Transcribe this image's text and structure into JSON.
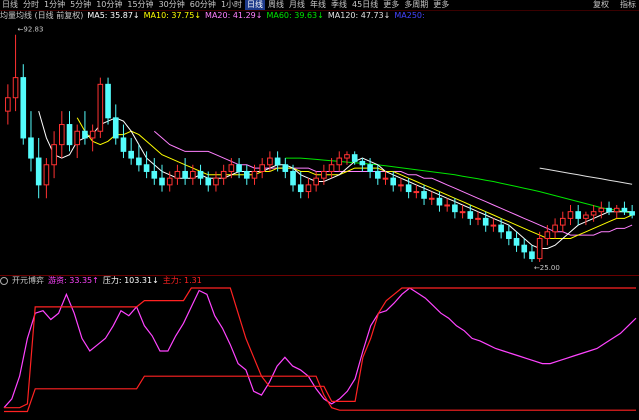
{
  "toolbar": {
    "items": [
      {
        "label": "日线",
        "active": false
      },
      {
        "label": "分时",
        "active": false
      },
      {
        "label": "1分钟",
        "active": false
      },
      {
        "label": "5分钟",
        "active": false
      },
      {
        "label": "10分钟",
        "active": false
      },
      {
        "label": "15分钟",
        "active": false
      },
      {
        "label": "30分钟",
        "active": false
      },
      {
        "label": "60分钟",
        "active": false
      },
      {
        "label": "1小时",
        "active": false
      },
      {
        "label": "日线",
        "active": true
      },
      {
        "label": "周线",
        "active": false
      },
      {
        "label": "月线",
        "active": false
      },
      {
        "label": "年线",
        "active": false
      },
      {
        "label": "季线",
        "active": false
      },
      {
        "label": "45日线",
        "active": false
      },
      {
        "label": "更多",
        "active": false
      },
      {
        "label": "多周期",
        "active": false
      },
      {
        "label": "更多",
        "active": false
      }
    ],
    "right": [
      "复权",
      "指标"
    ]
  },
  "legend": {
    "title": "均量均线 (日线 前复权)",
    "ma5": "MA5: 35.87↓",
    "ma10": "MA10: 37.75↓",
    "ma20": "MA20: 41.29↓",
    "ma60": "MA60: 39.63↓",
    "ma120": "MA120: 47.73↓",
    "ma250": "MA250:"
  },
  "sub_legend": {
    "title": "开元博弈",
    "item1": "游资: 33.35↑",
    "item2": "压力: 103.31↓",
    "item3": "主力: 1.31"
  },
  "colors": {
    "up": "#ff3232",
    "down": "#54fcfc",
    "ma5": "#ffffff",
    "ma10": "#ffff00",
    "ma20": "#ff80ff",
    "ma60": "#00e600",
    "ma120": "#e0e0e0",
    "ma250": "#4444ff",
    "sub_magenta": "#ff44ff",
    "sub_red": "#ff2222"
  },
  "chart_data": [
    {
      "type": "candlestick",
      "title": "",
      "y_annotations": [
        {
          "label": "92.83",
          "value": 92.83
        },
        {
          "label": "25.00",
          "value": 25.0
        }
      ],
      "ylim": [
        22,
        96
      ],
      "candles": [
        [
          70,
          78,
          66,
          74
        ],
        [
          74,
          92.8,
          70,
          80
        ],
        [
          80,
          84,
          60,
          62
        ],
        [
          62,
          70,
          52,
          56
        ],
        [
          56,
          62,
          44,
          48
        ],
        [
          48,
          56,
          44,
          54
        ],
        [
          54,
          64,
          50,
          60
        ],
        [
          60,
          70,
          56,
          66
        ],
        [
          66,
          70,
          58,
          60
        ],
        [
          60,
          66,
          56,
          64
        ],
        [
          64,
          70,
          60,
          62
        ],
        [
          62,
          66,
          58,
          64
        ],
        [
          64,
          80,
          62,
          78
        ],
        [
          78,
          80,
          66,
          68
        ],
        [
          68,
          72,
          60,
          62
        ],
        [
          62,
          66,
          56,
          58
        ],
        [
          58,
          62,
          54,
          56
        ],
        [
          56,
          60,
          52,
          54
        ],
        [
          54,
          58,
          50,
          52
        ],
        [
          52,
          56,
          48,
          50
        ],
        [
          50,
          54,
          46,
          48
        ],
        [
          48,
          52,
          46,
          50
        ],
        [
          50,
          54,
          48,
          52
        ],
        [
          52,
          56,
          48,
          50
        ],
        [
          50,
          54,
          48,
          52
        ],
        [
          52,
          54,
          48,
          50
        ],
        [
          50,
          52,
          46,
          48
        ],
        [
          48,
          52,
          46,
          50
        ],
        [
          50,
          54,
          48,
          52
        ],
        [
          52,
          56,
          50,
          54
        ],
        [
          54,
          56,
          50,
          52
        ],
        [
          52,
          54,
          48,
          50
        ],
        [
          50,
          54,
          48,
          52
        ],
        [
          52,
          56,
          50,
          54
        ],
        [
          54,
          58,
          52,
          56
        ],
        [
          56,
          58,
          52,
          54
        ],
        [
          54,
          56,
          50,
          52
        ],
        [
          52,
          54,
          46,
          48
        ],
        [
          48,
          52,
          44,
          46
        ],
        [
          46,
          50,
          44,
          48
        ],
        [
          48,
          52,
          46,
          50
        ],
        [
          50,
          54,
          48,
          52
        ],
        [
          52,
          56,
          50,
          54
        ],
        [
          54,
          58,
          52,
          56
        ],
        [
          56,
          58,
          54,
          57
        ],
        [
          57,
          58,
          54,
          55
        ],
        [
          55,
          56,
          52,
          54
        ],
        [
          54,
          56,
          50,
          52
        ],
        [
          52,
          54,
          48,
          50
        ],
        [
          50,
          52,
          48,
          50
        ],
        [
          50,
          52,
          46,
          48
        ],
        [
          48,
          50,
          46,
          48
        ],
        [
          48,
          50,
          44,
          46
        ],
        [
          46,
          48,
          44,
          46
        ],
        [
          46,
          48,
          42,
          44
        ],
        [
          44,
          46,
          42,
          44
        ],
        [
          44,
          46,
          40,
          42
        ],
        [
          42,
          44,
          40,
          42
        ],
        [
          42,
          44,
          38,
          40
        ],
        [
          40,
          42,
          38,
          40
        ],
        [
          40,
          42,
          36,
          38
        ],
        [
          38,
          40,
          36,
          38
        ],
        [
          38,
          40,
          34,
          36
        ],
        [
          36,
          38,
          34,
          36
        ],
        [
          36,
          38,
          32,
          34
        ],
        [
          34,
          36,
          30,
          32
        ],
        [
          32,
          34,
          28,
          30
        ],
        [
          30,
          32,
          26,
          28
        ],
        [
          28,
          30,
          25,
          26
        ],
        [
          26,
          34,
          25,
          32
        ],
        [
          32,
          36,
          30,
          34
        ],
        [
          34,
          38,
          32,
          36
        ],
        [
          36,
          40,
          34,
          38
        ],
        [
          38,
          42,
          36,
          40
        ],
        [
          40,
          42,
          36,
          38
        ],
        [
          38,
          40,
          36,
          39
        ],
        [
          39,
          42,
          37,
          40
        ],
        [
          40,
          43,
          38,
          41
        ],
        [
          41,
          43,
          39,
          40
        ],
        [
          40,
          42,
          38,
          41
        ],
        [
          41,
          43,
          39,
          40
        ],
        [
          40,
          42,
          38,
          39
        ]
      ],
      "ma5": [
        null,
        null,
        null,
        null,
        70,
        62,
        57,
        56,
        57,
        61,
        62,
        63,
        66,
        67,
        68,
        67,
        64,
        60,
        56,
        54,
        52,
        51,
        50,
        50,
        50,
        51,
        50,
        50,
        50,
        51,
        52,
        52,
        52,
        52,
        53,
        54,
        54,
        53,
        51,
        50,
        49,
        49,
        50,
        51,
        53,
        55,
        56,
        55,
        54,
        52,
        51,
        50,
        49,
        48,
        47,
        46,
        45,
        44,
        43,
        42,
        41,
        40,
        39,
        38,
        37,
        36,
        34,
        32,
        30,
        29,
        29,
        30,
        32,
        34,
        36,
        37,
        38,
        39,
        40,
        40,
        40,
        40
      ],
      "ma10": [
        null,
        null,
        null,
        null,
        null,
        null,
        null,
        null,
        null,
        68,
        64,
        61,
        60,
        61,
        63,
        63,
        64,
        63,
        61,
        59,
        57,
        56,
        55,
        54,
        53,
        52,
        51,
        51,
        51,
        51,
        51,
        51,
        51,
        52,
        52,
        53,
        53,
        53,
        52,
        52,
        51,
        51,
        51,
        51,
        52,
        53,
        53,
        53,
        53,
        52,
        52,
        51,
        50,
        49,
        48,
        47,
        46,
        45,
        44,
        43,
        42,
        41,
        40,
        39,
        38,
        37,
        36,
        35,
        34,
        33,
        32,
        32,
        32,
        32,
        33,
        34,
        35,
        36,
        37,
        38,
        38,
        39
      ],
      "ma20": [
        null,
        null,
        null,
        null,
        null,
        null,
        null,
        null,
        null,
        null,
        null,
        null,
        null,
        null,
        null,
        null,
        null,
        null,
        null,
        64,
        62,
        60,
        59,
        58,
        58,
        58,
        58,
        57,
        56,
        55,
        54,
        54,
        53,
        53,
        53,
        53,
        53,
        53,
        53,
        53,
        52,
        52,
        52,
        52,
        52,
        52,
        52,
        52,
        52,
        52,
        52,
        52,
        51,
        51,
        50,
        50,
        49,
        48,
        47,
        46,
        45,
        44,
        43,
        42,
        41,
        40,
        39,
        38,
        37,
        36,
        35,
        34,
        34,
        33,
        33,
        33,
        33,
        34,
        34,
        35,
        35,
        36
      ],
      "ma60": [
        null,
        null,
        null,
        null,
        null,
        null,
        null,
        null,
        null,
        null,
        null,
        null,
        null,
        null,
        null,
        null,
        null,
        null,
        null,
        null,
        null,
        null,
        null,
        null,
        null,
        null,
        null,
        null,
        null,
        null,
        null,
        null,
        null,
        null,
        null,
        null,
        56,
        56,
        56,
        55.8,
        55.6,
        55.4,
        55.2,
        55,
        54.8,
        54.6,
        54.4,
        54.2,
        54,
        53.7,
        53.4,
        53.1,
        52.8,
        52.5,
        52.2,
        51.9,
        51.6,
        51.3,
        51,
        50.6,
        50.2,
        49.8,
        49.4,
        49,
        48.5,
        48,
        47.5,
        47,
        46.5,
        46,
        45.4,
        44.8,
        44.2,
        43.6,
        43,
        42.4,
        41.8,
        41.2,
        40.8,
        40.4,
        40,
        39.6
      ],
      "ma120": [
        null,
        null,
        null,
        null,
        null,
        null,
        null,
        null,
        null,
        null,
        null,
        null,
        null,
        null,
        null,
        null,
        null,
        null,
        null,
        null,
        null,
        null,
        null,
        null,
        null,
        null,
        null,
        null,
        null,
        null,
        null,
        null,
        null,
        null,
        null,
        null,
        null,
        null,
        null,
        null,
        null,
        null,
        null,
        null,
        null,
        null,
        null,
        null,
        null,
        null,
        null,
        null,
        null,
        null,
        null,
        null,
        null,
        null,
        null,
        null,
        null,
        null,
        null,
        null,
        null,
        null,
        null,
        null,
        null,
        53,
        52.6,
        52.2,
        51.8,
        51.4,
        51,
        50.6,
        50.2,
        49.8,
        49.4,
        49,
        48.6,
        48.2
      ]
    },
    {
      "type": "line",
      "title": "",
      "ylim": [
        0,
        100
      ],
      "series": [
        {
          "name": "游资",
          "values": [
            5,
            12,
            30,
            60,
            80,
            82,
            75,
            80,
            95,
            80,
            60,
            50,
            55,
            60,
            70,
            82,
            78,
            85,
            70,
            62,
            50,
            50,
            62,
            72,
            85,
            98,
            95,
            78,
            68,
            55,
            40,
            35,
            18,
            15,
            25,
            38,
            45,
            38,
            35,
            30,
            20,
            12,
            8,
            12,
            18,
            28,
            50,
            70,
            80,
            82,
            88,
            95,
            100,
            96,
            92,
            86,
            80,
            76,
            70,
            66,
            60,
            58,
            55,
            52,
            50,
            48,
            46,
            44,
            42,
            40,
            40,
            42,
            44,
            46,
            48,
            50,
            52,
            56,
            60,
            64,
            70,
            76
          ]
        },
        {
          "name": "压力",
          "values": [
            5,
            5,
            5,
            8,
            85,
            85,
            85,
            85,
            85,
            85,
            85,
            85,
            85,
            85,
            85,
            85,
            85,
            85,
            90,
            90,
            90,
            90,
            90,
            90,
            100,
            100,
            100,
            100,
            100,
            100,
            80,
            60,
            45,
            30,
            22,
            22,
            22,
            22,
            22,
            22,
            22,
            22,
            10,
            10,
            10,
            10,
            45,
            60,
            80,
            90,
            95,
            100,
            100,
            100,
            100,
            100,
            100,
            100,
            100,
            100,
            100,
            100,
            100,
            100,
            100,
            100,
            100,
            100,
            100,
            100,
            100,
            100,
            100,
            100,
            100,
            100,
            100,
            100,
            100,
            100,
            100,
            100
          ]
        },
        {
          "name": "主力",
          "values": [
            2,
            2,
            2,
            2,
            20,
            20,
            20,
            20,
            20,
            20,
            20,
            20,
            20,
            20,
            20,
            20,
            20,
            20,
            30,
            30,
            30,
            30,
            30,
            30,
            30,
            30,
            30,
            30,
            30,
            30,
            30,
            30,
            30,
            30,
            30,
            30,
            30,
            30,
            30,
            30,
            30,
            15,
            5,
            3,
            3,
            3,
            3,
            3,
            3,
            3,
            3,
            3,
            3,
            3,
            3,
            3,
            3,
            3,
            3,
            3,
            3,
            3,
            3,
            3,
            3,
            3,
            3,
            3,
            3,
            3,
            3,
            3,
            3,
            3,
            3,
            3,
            3,
            3,
            3,
            3,
            3,
            3
          ]
        }
      ]
    }
  ]
}
